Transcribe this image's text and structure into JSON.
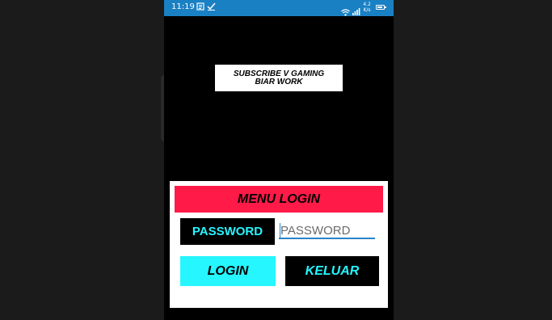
{
  "status_bar": {
    "time": "11:19",
    "speed": "4.2\nK/s",
    "icons": [
      "news-icon",
      "check-icon",
      "wifi-icon",
      "signal-icon",
      "battery-icon"
    ]
  },
  "banner": {
    "line1": "SUBSCRIBE V GAMING",
    "line2": "BIAR WORK"
  },
  "login_panel": {
    "title": "MENU LOGIN",
    "password_label": "PASSWORD",
    "password_placeholder": "PASSWORD",
    "password_value": "",
    "login_label": "LOGIN",
    "exit_label": "KELUAR"
  },
  "colors": {
    "status_bar": "#1a80c4",
    "header": "#ff1a48",
    "cyan": "#25f6ff",
    "input_underline": "#2a84c8"
  }
}
